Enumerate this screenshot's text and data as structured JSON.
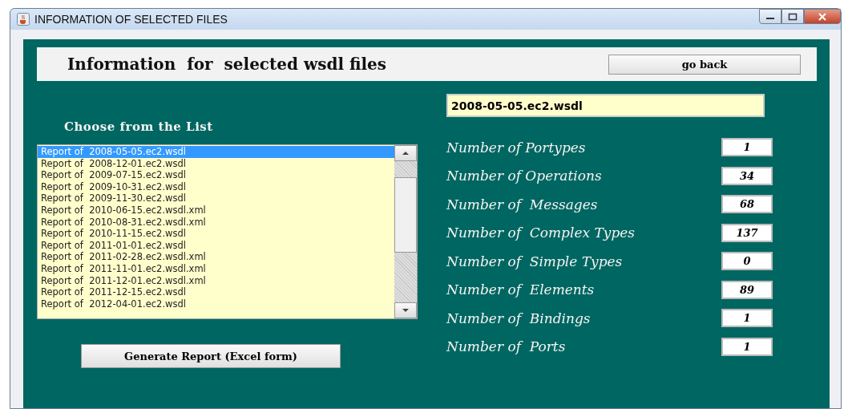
{
  "window": {
    "title": "INFORMATION OF SELECTED FILES"
  },
  "header": {
    "title": "Information  for  selected wsdl files",
    "back_button": "go back"
  },
  "list_label": "Choose from the List",
  "files": [
    {
      "label": "Report of  2008-05-05.ec2.wsdl",
      "selected": true
    },
    {
      "label": "Report of  2008-12-01.ec2.wsdl",
      "selected": false
    },
    {
      "label": "Report of  2009-07-15.ec2.wsdl",
      "selected": false
    },
    {
      "label": "Report of  2009-10-31.ec2.wsdl",
      "selected": false
    },
    {
      "label": "Report of  2009-11-30.ec2.wsdl",
      "selected": false
    },
    {
      "label": "Report of  2010-06-15.ec2.wsdl.xml",
      "selected": false
    },
    {
      "label": "Report of  2010-08-31.ec2.wsdl.xml",
      "selected": false
    },
    {
      "label": "Report of  2010-11-15.ec2.wsdl",
      "selected": false
    },
    {
      "label": "Report of  2011-01-01.ec2.wsdl",
      "selected": false
    },
    {
      "label": "Report of  2011-02-28.ec2.wsdl.xml",
      "selected": false
    },
    {
      "label": "Report of  2011-11-01.ec2.wsdl.xml",
      "selected": false
    },
    {
      "label": "Report of  2011-12-01.ec2.wsdl.xml",
      "selected": false
    },
    {
      "label": "Report of  2011-12-15.ec2.wsdl",
      "selected": false
    },
    {
      "label": "Report of  2012-04-01.ec2.wsdl",
      "selected": false
    }
  ],
  "generate_button": "Generate Report (Excel form)",
  "selected_file": "2008-05-05.ec2.wsdl",
  "stats": [
    {
      "label": "Number of Portypes",
      "value": "1"
    },
    {
      "label": "Number of Operations",
      "value": "34"
    },
    {
      "label": "Number of  Messages",
      "value": "68"
    },
    {
      "label": "Number of  Complex Types",
      "value": "137"
    },
    {
      "label": "Number of  Simple Types",
      "value": "0"
    },
    {
      "label": "Number of  Elements",
      "value": "89"
    },
    {
      "label": "Number of  Bindings",
      "value": "1"
    },
    {
      "label": "Number of  Ports",
      "value": "1"
    }
  ]
}
